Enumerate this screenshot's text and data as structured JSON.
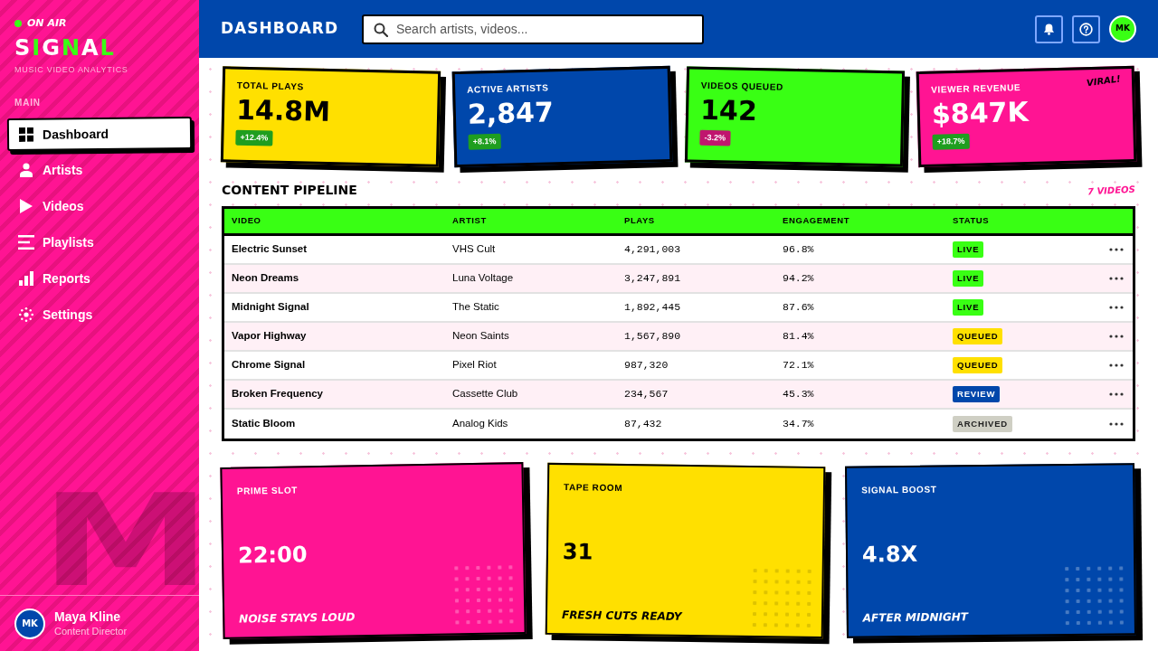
{
  "sidebar": {
    "on_air": "ON AIR",
    "logo": [
      {
        "text": "S",
        "accent": false
      },
      {
        "text": "I",
        "accent": true
      },
      {
        "text": "G",
        "accent": false
      },
      {
        "text": "N",
        "accent": true
      },
      {
        "text": "A",
        "accent": false
      },
      {
        "text": "L",
        "accent": true
      }
    ],
    "tagline": "MUSIC VIDEO ANALYTICS",
    "section_label": "MAIN",
    "items": [
      {
        "label": "Dashboard",
        "selected": true
      },
      {
        "label": "Artists",
        "selected": false
      },
      {
        "label": "Videos",
        "selected": false
      },
      {
        "label": "Playlists",
        "selected": false
      },
      {
        "label": "Reports",
        "selected": false
      },
      {
        "label": "Settings",
        "selected": false
      }
    ],
    "background_letter": "M",
    "user": {
      "initials": "MK",
      "name": "Maya Kline",
      "role": "Content Director"
    }
  },
  "header": {
    "title": "DASHBOARD",
    "search": {
      "placeholder": "Search artists, videos..."
    },
    "avatar": "MK"
  },
  "stats": [
    {
      "label": "TOTAL PLAYS",
      "value": "14.8M",
      "change": {
        "text": "+12.4%",
        "kind": "up"
      },
      "color": "#ffe000"
    },
    {
      "label": "ACTIVE ARTISTS",
      "value": "2,847",
      "change": {
        "text": "+8.1%",
        "kind": "up"
      },
      "color": "#0047ab"
    },
    {
      "label": "VIDEOS QUEUED",
      "value": "142",
      "change": {
        "text": "-3.2%",
        "kind": "down"
      },
      "color": "#39ff14"
    },
    {
      "label": "VIEWER REVENUE",
      "value": "$847K",
      "change": {
        "text": "+18.7%",
        "kind": "up"
      },
      "color": "#ff1493",
      "tag": "VIRAL!"
    }
  ],
  "pipeline": {
    "title": "CONTENT PIPELINE",
    "count": "7 VIDEOS",
    "table": {
      "columns": [
        "VIDEO",
        "ARTIST",
        "PLAYS",
        "ENGAGEMENT",
        "STATUS"
      ],
      "rows": [
        {
          "video": "Electric Sunset",
          "artist": "VHS Cult",
          "plays": "4,291,003",
          "engagement": "96.8%",
          "status": {
            "label": "LIVE",
            "kind": "live"
          }
        },
        {
          "video": "Neon Dreams",
          "artist": "Luna Voltage",
          "plays": "3,247,891",
          "engagement": "94.2%",
          "status": {
            "label": "LIVE",
            "kind": "live"
          }
        },
        {
          "video": "Midnight Signal",
          "artist": "The Static",
          "plays": "1,892,445",
          "engagement": "87.6%",
          "status": {
            "label": "LIVE",
            "kind": "live"
          }
        },
        {
          "video": "Vapor Highway",
          "artist": "Neon Saints",
          "plays": "1,567,890",
          "engagement": "81.4%",
          "status": {
            "label": "QUEUED",
            "kind": "queued"
          }
        },
        {
          "video": "Chrome Signal",
          "artist": "Pixel Riot",
          "plays": "987,320",
          "engagement": "72.1%",
          "status": {
            "label": "QUEUED",
            "kind": "queued"
          }
        },
        {
          "video": "Broken Frequency",
          "artist": "Cassette Club",
          "plays": "234,567",
          "engagement": "45.3%",
          "status": {
            "label": "REVIEW",
            "kind": "review"
          }
        },
        {
          "video": "Static Bloom",
          "artist": "Analog Kids",
          "plays": "87,432",
          "engagement": "34.7%",
          "status": {
            "label": "ARCHIVED",
            "kind": "archived"
          }
        }
      ]
    }
  },
  "highlights": [
    {
      "label": "PRIME SLOT",
      "value": "22:00",
      "tagline": "NOISE STAYS LOUD",
      "color": "#ff1493"
    },
    {
      "label": "TAPE ROOM",
      "value": "31",
      "tagline": "FRESH CUTS READY",
      "color": "#ffe000"
    },
    {
      "label": "SIGNAL BOOST",
      "value": "4.8X",
      "tagline": "AFTER MIDNIGHT",
      "color": "#0047ab"
    }
  ]
}
